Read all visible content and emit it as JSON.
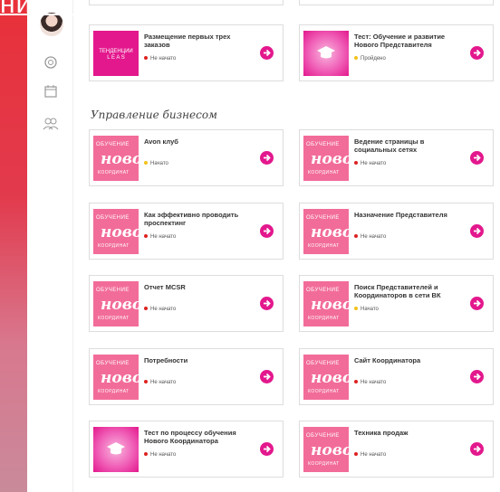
{
  "header_overlay": "ние бизнесом»",
  "section_title": "Управление бизнесом",
  "colors": {
    "accent": "#e3188d",
    "thumb_pink": "#f26c9a",
    "status_red": "#d22222",
    "status_yellow": "#f2c21b"
  },
  "thumb_text": {
    "line1": "ОБУЧЕНИЕ",
    "line2": "ново",
    "line3": "КООРДИНАТ"
  },
  "brand_thumb": "ТЕНДЕНЦИИ\nL E A S",
  "cards": [
    {
      "title": "Размещение первых трех заказов",
      "status": "Не начато",
      "status_color": "red",
      "thumb": "brand"
    },
    {
      "title": "Тест: Обучение и развитие Нового Представителя",
      "status": "Пройдено",
      "status_color": "yellow",
      "thumb": "cap"
    },
    {
      "title": "Avon клуб",
      "status": "Начато",
      "status_color": "yellow",
      "thumb": "novo"
    },
    {
      "title": "Ведение страницы в социальных сетях",
      "status": "Не начато",
      "status_color": "red",
      "thumb": "novo"
    },
    {
      "title": "Как эффективно проводить проспектинг",
      "status": "Не начато",
      "status_color": "red",
      "thumb": "novo"
    },
    {
      "title": "Назначение Представителя",
      "status": "Не начато",
      "status_color": "red",
      "thumb": "novo"
    },
    {
      "title": "Отчет MCSR",
      "status": "Не начато",
      "status_color": "red",
      "thumb": "novo"
    },
    {
      "title": "Поиск Представителей и Координаторов в сети ВК",
      "status": "Начато",
      "status_color": "yellow",
      "thumb": "novo"
    },
    {
      "title": "Потребности",
      "status": "Не начато",
      "status_color": "red",
      "thumb": "novo"
    },
    {
      "title": "Сайт Координатора",
      "status": "Не начато",
      "status_color": "red",
      "thumb": "novo"
    },
    {
      "title": "Тест по процессу обучения Нового Координатора",
      "status": "Не начато",
      "status_color": "red",
      "thumb": "cap"
    },
    {
      "title": "Техника продаж",
      "status": "Не начато",
      "status_color": "red",
      "thumb": "novo"
    }
  ],
  "rail_icons": [
    "avatar",
    "search-icon",
    "calendar-icon",
    "people-icon"
  ]
}
